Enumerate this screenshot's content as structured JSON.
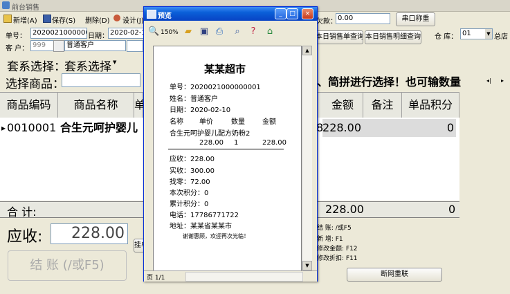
{
  "app": {
    "title": "前台销售",
    "minimize": "_",
    "maximize": "□",
    "close": "×"
  },
  "toolbar": {
    "new": "新增(A)",
    "save": "保存(S)",
    "delete": "删除(D)",
    "design": "设计(J)"
  },
  "header": {
    "bill_no_label": "单号：",
    "bill_no": "2020021000000001",
    "date_label": "日期：",
    "date": "2020-02-10",
    "customer_label": "客 户：",
    "customer_code": "999",
    "customer_name": "普通客户",
    "owe_label": "欠款：",
    "owe_value": "0.00",
    "serial_button": "串口称重",
    "today_bills_button": "本日销售单查询",
    "today_detail_button": "本日销售明细查询",
    "warehouse_label": "仓 库：",
    "warehouse_value": "01",
    "total_store": "总店"
  },
  "set_select": {
    "label": "套系选择：",
    "value": "套系选择"
  },
  "product_select": {
    "label": "选择商品：",
    "hint": "、简拼进行选择！也可输数量"
  },
  "grid": {
    "columns": [
      "商品编码",
      "商品名称",
      "单",
      "金额",
      "备注",
      "单品积分"
    ],
    "rows": [
      {
        "marker": "▸",
        "code": "0010001",
        "name": "合生元呵护婴儿",
        "partial": "8",
        "amount": "228.00",
        "note": "",
        "points": "0"
      }
    ],
    "total_label": "合  计:",
    "total_amount": "228.00",
    "total_points": "0"
  },
  "receivable": {
    "label": "应收:",
    "value": "228.00"
  },
  "checkout_button": "结  账 (/或F5)",
  "partial_button": "挂单",
  "cloud_button": "断网重联",
  "hotkeys": [
    "结  账: /或F5",
    "新  增: F1",
    "修改金额: F12",
    "修改折扣: F11"
  ],
  "preview": {
    "title": "预览",
    "zoom": "150%",
    "page": "页 1/1",
    "receipt": {
      "shop": "某某超市",
      "no_line": "单号：2020021000000001",
      "name_line": "姓名：普通客户",
      "date_line": "日期：2020-02-10",
      "head": [
        "名称",
        "单价",
        "数量",
        "金额"
      ],
      "item_name": "合生元呵护婴儿配方奶粉2",
      "item_price": "228.00",
      "item_qty": "1",
      "item_amount": "228.00",
      "due": "应收：228.00",
      "paid": "实收：300.00",
      "change": "找零：72.00",
      "points_now": "本次积分：0",
      "points_total": "累计积分：0",
      "phone": "电话：17786771722",
      "address": "地址：某某省某某市",
      "thanks": "谢谢惠顾，欢迎再次光临！"
    }
  },
  "colors": {
    "titlebar": "#0a5fd8",
    "window_bg": "#ece9d8"
  }
}
